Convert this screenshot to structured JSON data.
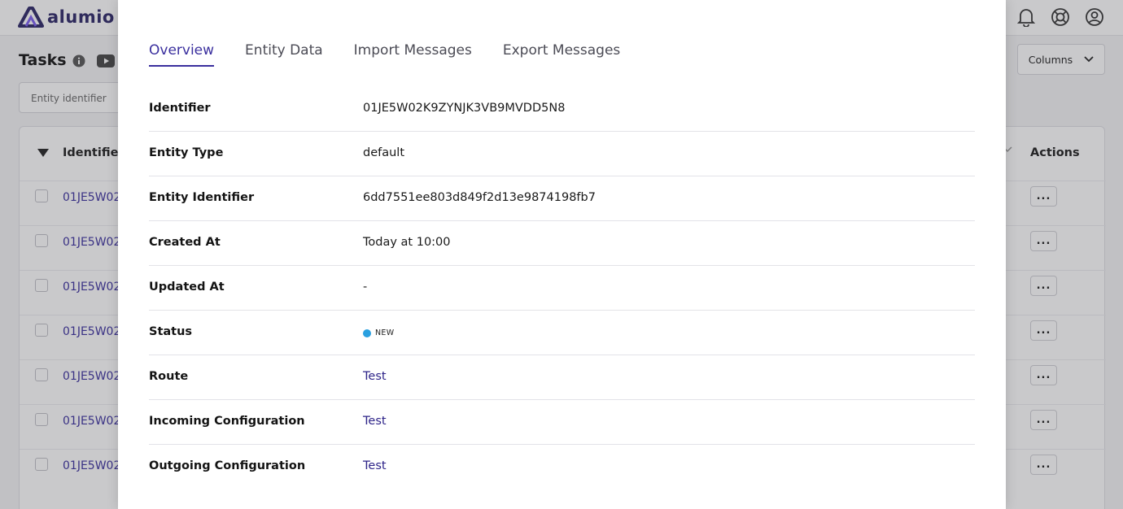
{
  "app": {
    "logo_text": "alumio",
    "page_title": "Tasks",
    "filter_placeholder": "Entity identifier",
    "columns_button": "Columns",
    "table": {
      "headers": {
        "identifier": "Identifier",
        "actions": "Actions"
      },
      "rows": [
        {
          "identifier": "01JE5W02",
          "actions": "..."
        },
        {
          "identifier": "01JE5W02",
          "actions": "..."
        },
        {
          "identifier": "01JE5W02",
          "actions": "..."
        },
        {
          "identifier": "01JE5W02",
          "actions": "..."
        },
        {
          "identifier": "01JE5W02",
          "actions": "..."
        },
        {
          "identifier": "01JE5W02",
          "actions": "..."
        },
        {
          "identifier": "01JE5W02",
          "actions": "..."
        }
      ]
    }
  },
  "modal": {
    "tabs": [
      {
        "label": "Overview",
        "active": true
      },
      {
        "label": "Entity Data",
        "active": false
      },
      {
        "label": "Import Messages",
        "active": false
      },
      {
        "label": "Export Messages",
        "active": false
      }
    ],
    "fields": {
      "identifier": {
        "label": "Identifier",
        "value": "01JE5W02K9ZYNJK3VB9MVDD5N8"
      },
      "entity_type": {
        "label": "Entity Type",
        "value": "default"
      },
      "entity_identifier": {
        "label": "Entity Identifier",
        "value": "6dd7551ee803d849f2d13e9874198fb7"
      },
      "created_at": {
        "label": "Created At",
        "value": "Today at 10:00"
      },
      "updated_at": {
        "label": "Updated At",
        "value": "-"
      },
      "status": {
        "label": "Status",
        "value": "NEW",
        "color": "#2aa0e0"
      },
      "route": {
        "label": "Route",
        "value": "Test"
      },
      "incoming_configuration": {
        "label": "Incoming Configuration",
        "value": "Test"
      },
      "outgoing_configuration": {
        "label": "Outgoing Configuration",
        "value": "Test"
      }
    }
  },
  "colors": {
    "brand": "#2a2466",
    "link": "#2e2489",
    "status_new": "#2aa0e0"
  },
  "icons": [
    "logo-icon",
    "bell-icon",
    "help-icon",
    "user-icon",
    "info-icon",
    "youtube-icon",
    "sort-desc-icon",
    "chevron-down-icon"
  ]
}
